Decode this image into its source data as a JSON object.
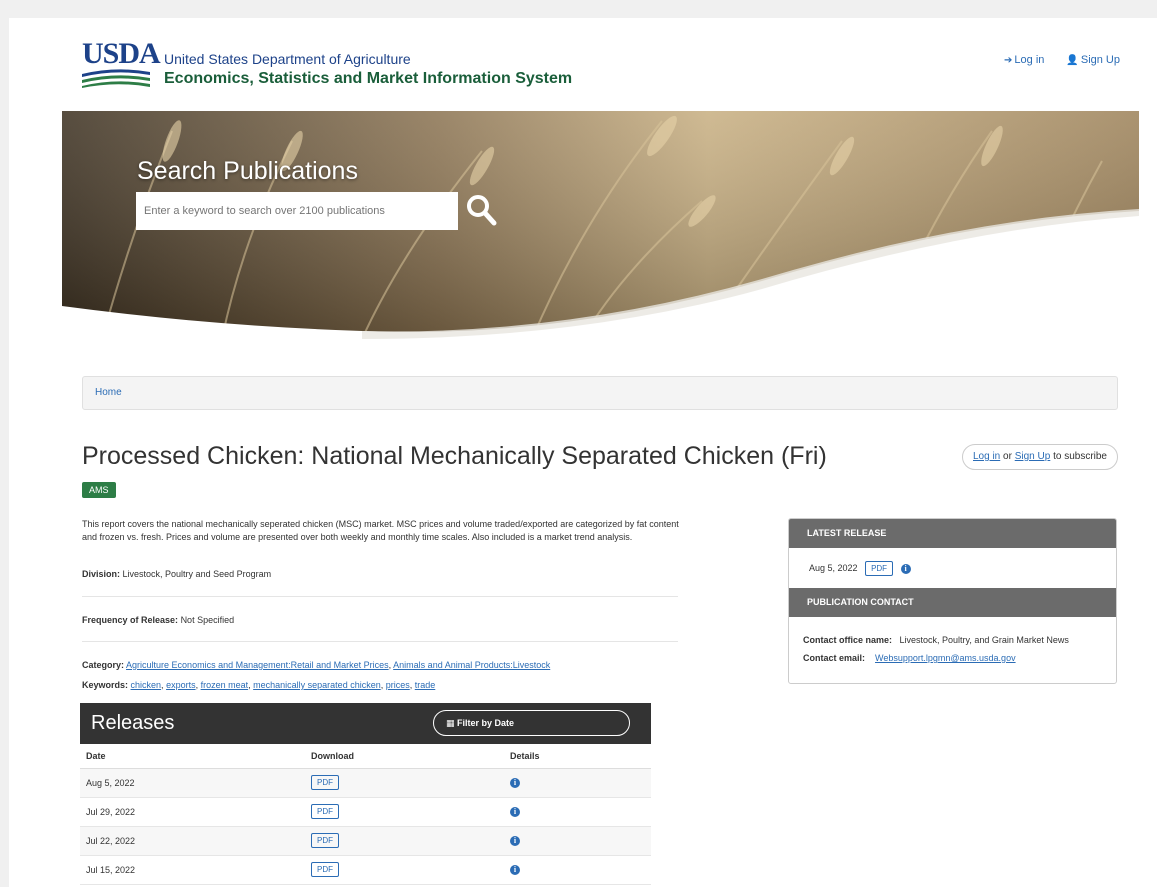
{
  "header": {
    "logo_text": "USDA",
    "agency": "United States Department of Agriculture",
    "system": "Economics, Statistics and Market Information System",
    "login_label": "Log in",
    "signup_label": "Sign Up"
  },
  "banner": {
    "title": "Search Publications",
    "search_placeholder": "Enter a keyword to search over 2100 publications"
  },
  "breadcrumb": {
    "home": "Home"
  },
  "publication": {
    "title": "Processed Chicken: National Mechanically Separated Chicken (Fri)",
    "badge": "AMS",
    "subscribe_login": "Log in",
    "subscribe_or": "or",
    "subscribe_signup": "Sign Up",
    "subscribe_suffix": "to subscribe",
    "description": "This report covers the national mechanically seperated chicken (MSC) market. MSC prices and volume traded/exported are categorized by fat content and frozen vs. fresh. Prices and volume are presented over both weekly and monthly time scales. Also included is a market trend analysis.",
    "division_label": "Division:",
    "division_value": "Livestock, Poultry and Seed Program",
    "frequency_label": "Frequency of Release:",
    "frequency_value": "Not Specified",
    "category_label": "Category:",
    "categories": [
      "Agriculture Economics and Management:Retail and Market Prices",
      "Animals and Animal Products:Livestock"
    ],
    "keywords_label": "Keywords:",
    "keywords": [
      "chicken",
      "exports",
      "frozen meat",
      "mechanically separated chicken",
      "prices",
      "trade"
    ]
  },
  "releases": {
    "title": "Releases",
    "filter_label": "Filter by Date",
    "columns": [
      "Date",
      "Download",
      "Details"
    ],
    "rows": [
      {
        "date": "Aug 5, 2022",
        "download": "PDF"
      },
      {
        "date": "Jul 29, 2022",
        "download": "PDF"
      },
      {
        "date": "Jul 22, 2022",
        "download": "PDF"
      },
      {
        "date": "Jul 15, 2022",
        "download": "PDF"
      }
    ]
  },
  "sidebar": {
    "latest_release_heading": "LATEST RELEASE",
    "latest_date": "Aug 5, 2022",
    "latest_pdf": "PDF",
    "contact_heading": "PUBLICATION CONTACT",
    "contact_office_label": "Contact office name:",
    "contact_office_value": "Livestock, Poultry, and Grain Market News",
    "contact_email_label": "Contact email:",
    "contact_email_value": "Websupport.lpgmn@ams.usda.gov"
  },
  "colors": {
    "usda_blue": "#1d4289",
    "usda_green": "#1a5e3a",
    "link": "#2b6cb5",
    "badge_green": "#2d7d46",
    "panel_gray": "#6b6b6b"
  },
  "icons": [
    "login-icon",
    "signup-icon",
    "search-icon",
    "calendar-icon",
    "info-icon"
  ]
}
